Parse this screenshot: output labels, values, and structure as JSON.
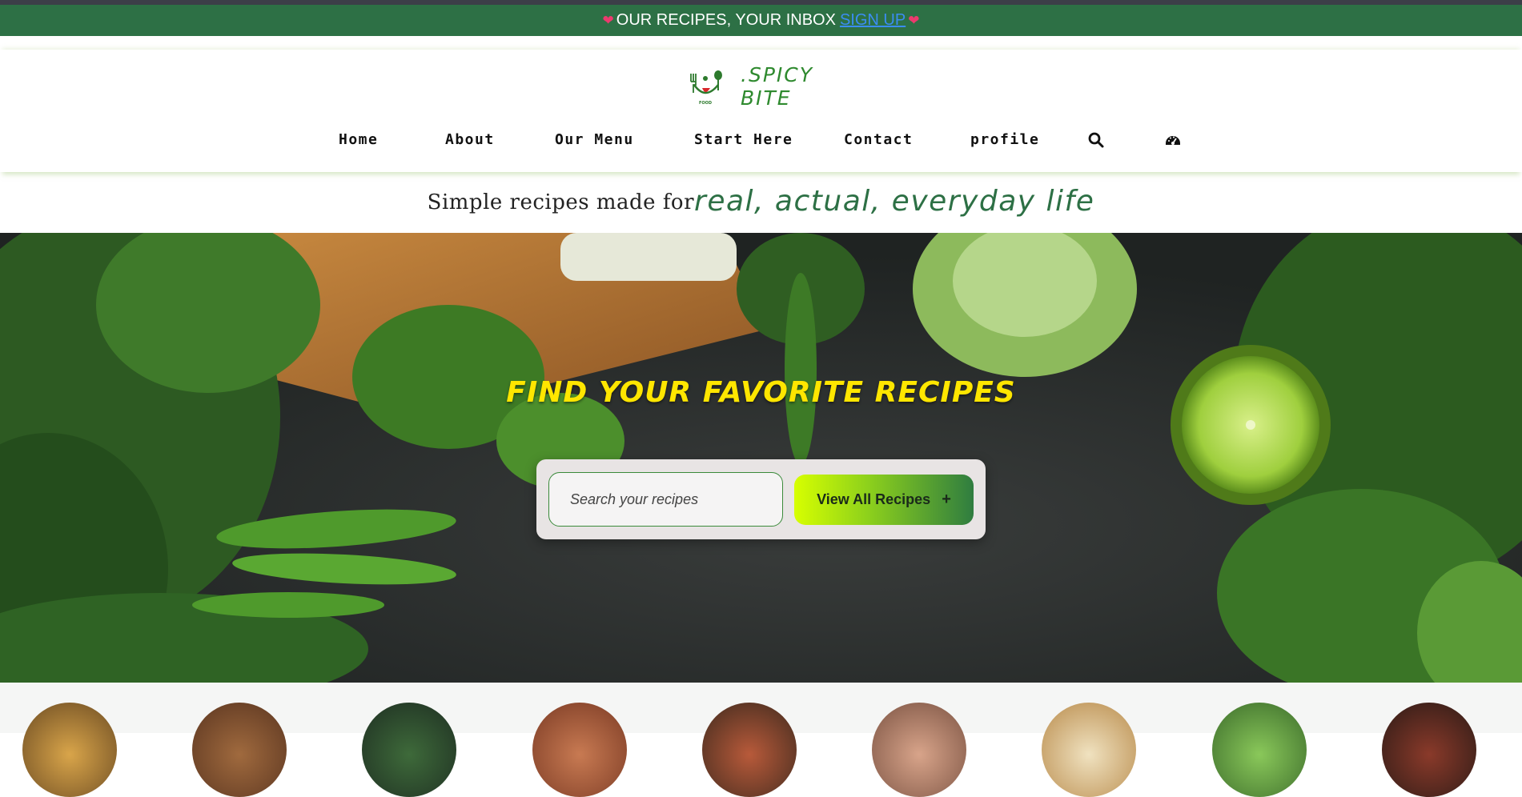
{
  "announcement": {
    "text": "OUR RECIPES, YOUR INBOX",
    "link": "SIGN UP",
    "heart_icon": "heart-icon",
    "heart_color": "#ec3a6e"
  },
  "brand": {
    "name": ".SPICY BITE",
    "logo_small_text": "FOOD",
    "color": "#2f8a2f"
  },
  "nav": {
    "items": [
      {
        "label": "Home"
      },
      {
        "label": "About"
      },
      {
        "label": "Our Menu"
      },
      {
        "label": "Start Here"
      },
      {
        "label": "Contact"
      },
      {
        "label": "profile"
      }
    ],
    "icons": [
      "search-icon",
      "dashboard-gauge-icon"
    ]
  },
  "tagline": {
    "plain": "Simple recipes made for",
    "highlight": "real, actual, everyday life"
  },
  "hero": {
    "title": "FIND YOUR FAVORITE RECIPES",
    "search_placeholder": "Search your recipes",
    "button_label": "View All Recipes",
    "button_icon": "plus-icon"
  },
  "colors": {
    "primary_green": "#2d7045",
    "title_yellow": "#ffe600",
    "link_blue": "#3b8cf2",
    "button_gradient_start": "#d7ff00",
    "button_gradient_end": "#2f7d40"
  },
  "categories": {
    "count_visible": 9
  }
}
